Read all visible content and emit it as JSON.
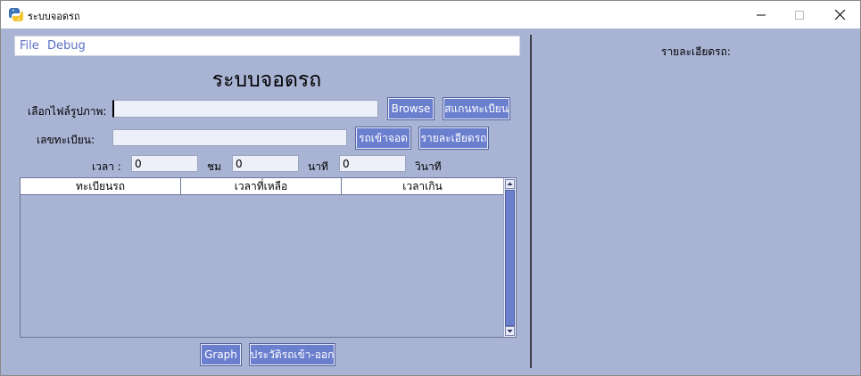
{
  "window": {
    "title": "ระบบจอดรถ",
    "minimize_glyph": "—",
    "maximize_glyph": "☐",
    "close_glyph": "✕",
    "icon": "python-icon"
  },
  "menu": {
    "file": "File",
    "debug": "Debug"
  },
  "app_title": "ระบบจอดรถ",
  "image_row": {
    "label": "เลือกไฟล์รูปภาพ:",
    "value": "",
    "browse": "Browse",
    "scan": "สแกนทะเบียน"
  },
  "plate_row": {
    "label": "เลขทะเบียน:",
    "value": "",
    "park": "รถเข้าจอด",
    "details": "รายละเอียดรถ"
  },
  "time_row": {
    "label": "เวลา :",
    "hours_value": "0",
    "hours_unit": "ชม",
    "minutes_value": "0",
    "minutes_unit": "นาที",
    "seconds_value": "0",
    "seconds_unit": "วินาที"
  },
  "table": {
    "columns": [
      "ทะเบียนรถ",
      "เวลาที่เหลือ",
      "เวลาเกิน"
    ],
    "rows": []
  },
  "bottom": {
    "graph": "Graph",
    "history": "ประวัติรถเข้า-ออก"
  },
  "right_panel": {
    "label": "รายละเอียดรถ:"
  },
  "colors": {
    "background": "#a9b3d4",
    "button": "#6b7fcf",
    "menu_text": "#5a6fc4"
  }
}
